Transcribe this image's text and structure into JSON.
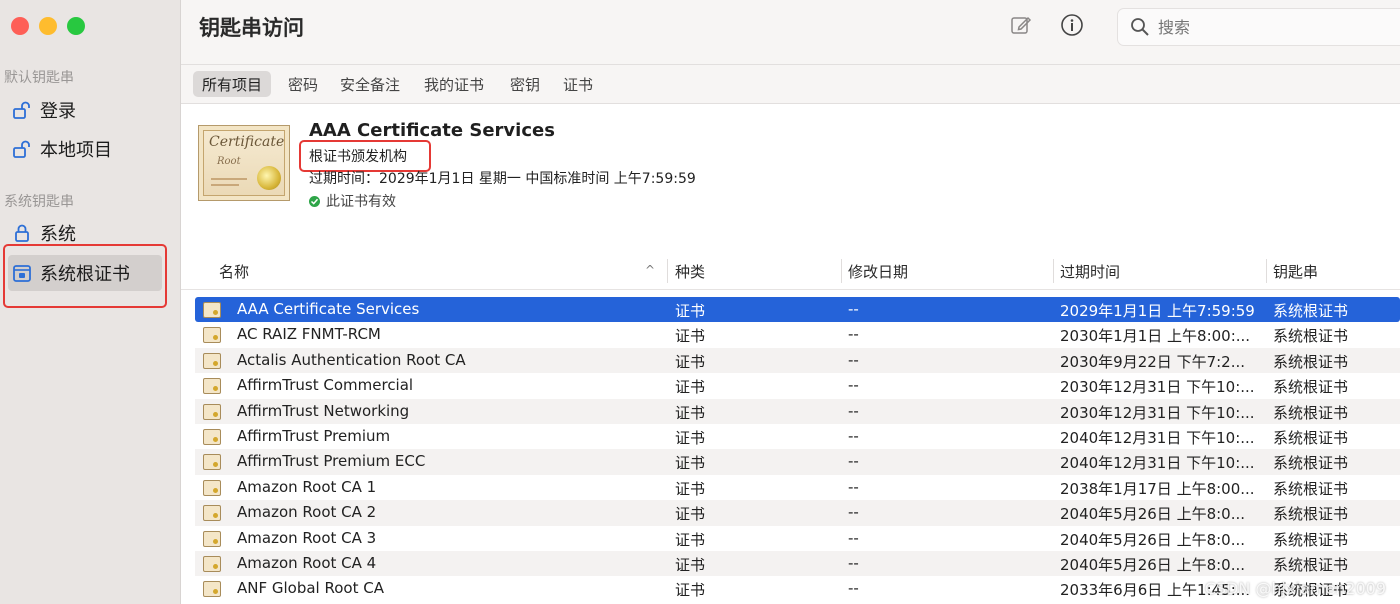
{
  "window": {
    "title": "钥匙串访问"
  },
  "sidebar": {
    "sections": [
      {
        "label": "默认钥匙串",
        "items": [
          {
            "label": "登录"
          },
          {
            "label": "本地项目"
          }
        ]
      },
      {
        "label": "系统钥匙串",
        "items": [
          {
            "label": "系统"
          },
          {
            "label": "系统根证书"
          }
        ]
      }
    ]
  },
  "search": {
    "placeholder": "搜索"
  },
  "tabs": [
    "所有项目",
    "密码",
    "安全备注",
    "我的证书",
    "密钥",
    "证书"
  ],
  "detail": {
    "name": "AAA Certificate Services",
    "kind": "根证书颁发机构",
    "expiry": "过期时间：2029年1月1日 星期一 中国标准时间 上午7:59:59",
    "status": "此证书有效",
    "image_text": "Certificate",
    "image_sub": "Root"
  },
  "table": {
    "columns": [
      "名称",
      "种类",
      "修改日期",
      "过期时间",
      "钥匙串"
    ],
    "rows": [
      [
        "AAA Certificate Services",
        "证书",
        "--",
        "2029年1月1日 上午7:59:59",
        "系统根证书"
      ],
      [
        "AC RAIZ FNMT-RCM",
        "证书",
        "--",
        "2030年1月1日 上午8:00:...",
        "系统根证书"
      ],
      [
        "Actalis Authentication Root CA",
        "证书",
        "--",
        "2030年9月22日 下午7:2...",
        "系统根证书"
      ],
      [
        "AffirmTrust Commercial",
        "证书",
        "--",
        "2030年12月31日 下午10:...",
        "系统根证书"
      ],
      [
        "AffirmTrust Networking",
        "证书",
        "--",
        "2030年12月31日 下午10:...",
        "系统根证书"
      ],
      [
        "AffirmTrust Premium",
        "证书",
        "--",
        "2040年12月31日 下午10:...",
        "系统根证书"
      ],
      [
        "AffirmTrust Premium ECC",
        "证书",
        "--",
        "2040年12月31日 下午10:...",
        "系统根证书"
      ],
      [
        "Amazon Root CA 1",
        "证书",
        "--",
        "2038年1月17日 上午8:00...",
        "系统根证书"
      ],
      [
        "Amazon Root CA 2",
        "证书",
        "--",
        "2040年5月26日 上午8:0...",
        "系统根证书"
      ],
      [
        "Amazon Root CA 3",
        "证书",
        "--",
        "2040年5月26日 上午8:0...",
        "系统根证书"
      ],
      [
        "Amazon Root CA 4",
        "证书",
        "--",
        "2040年5月26日 上午8:0...",
        "系统根证书"
      ],
      [
        "ANF Global Root CA",
        "证书",
        "--",
        "2033年6月6日 上午1:45:...",
        "系统根证书"
      ]
    ]
  },
  "watermark": "CSDN @hjxiamen2009",
  "colors": {
    "selection": "#2563d9",
    "highlight_box": "#e53935",
    "valid": "#2ea548"
  }
}
